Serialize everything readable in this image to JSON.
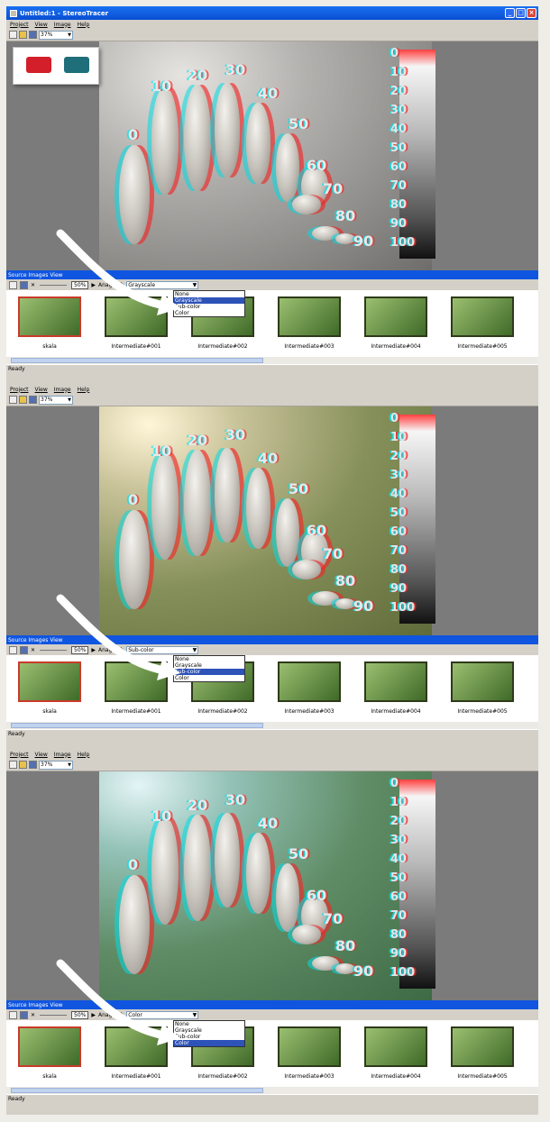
{
  "window": {
    "title": "Untitled:1 - StereoTracer"
  },
  "menu": [
    "Project",
    "View",
    "Image",
    "Help"
  ],
  "toolbar": {
    "zoom": "37%"
  },
  "viewer": {
    "stone_labels": [
      "0",
      "10",
      "20",
      "30",
      "40",
      "50",
      "60",
      "70",
      "80",
      "90"
    ],
    "scale_labels": [
      "0",
      "10",
      "20",
      "30",
      "40",
      "50",
      "60",
      "70",
      "80",
      "90",
      "100"
    ]
  },
  "panel": {
    "title": "Source Images View",
    "zoom": "50%",
    "anaglyph_label": "Anaglyph",
    "options": [
      "None",
      "Grayscale",
      "Sub-color",
      "Color"
    ]
  },
  "thumbnails": [
    "skala",
    "Intermediate#001",
    "Intermediate#002",
    "Intermediate#003",
    "Intermediate#004",
    "Intermediate#005"
  ],
  "status": "Ready",
  "sections": [
    {
      "anaglyph": "Grayscale"
    },
    {
      "anaglyph": "Sub-color"
    },
    {
      "anaglyph": "Color"
    }
  ],
  "colors": {
    "selection": "#2d52b8",
    "header": "#1055e0",
    "active_thumb": "#c93b2a"
  }
}
